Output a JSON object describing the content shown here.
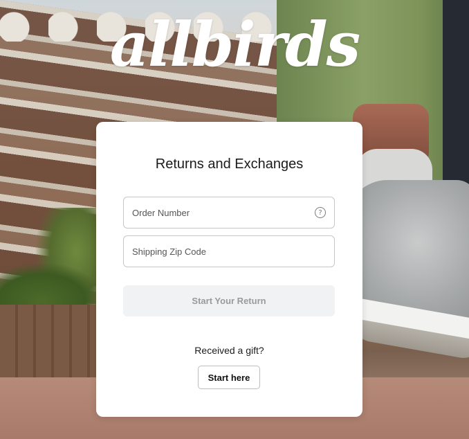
{
  "brand": {
    "logo_text": "allbirds"
  },
  "form": {
    "title": "Returns and Exchanges",
    "order_number_placeholder": "Order Number",
    "order_number_help": "?",
    "zip_placeholder": "Shipping Zip Code",
    "submit_label": "Start Your Return"
  },
  "gift": {
    "prompt": "Received a gift?",
    "button_label": "Start here"
  },
  "colors": {
    "card_background": "#ffffff",
    "disabled_button_bg": "#f1f2f4",
    "disabled_button_text": "#9a9a9a",
    "logo": "#ffffff"
  }
}
